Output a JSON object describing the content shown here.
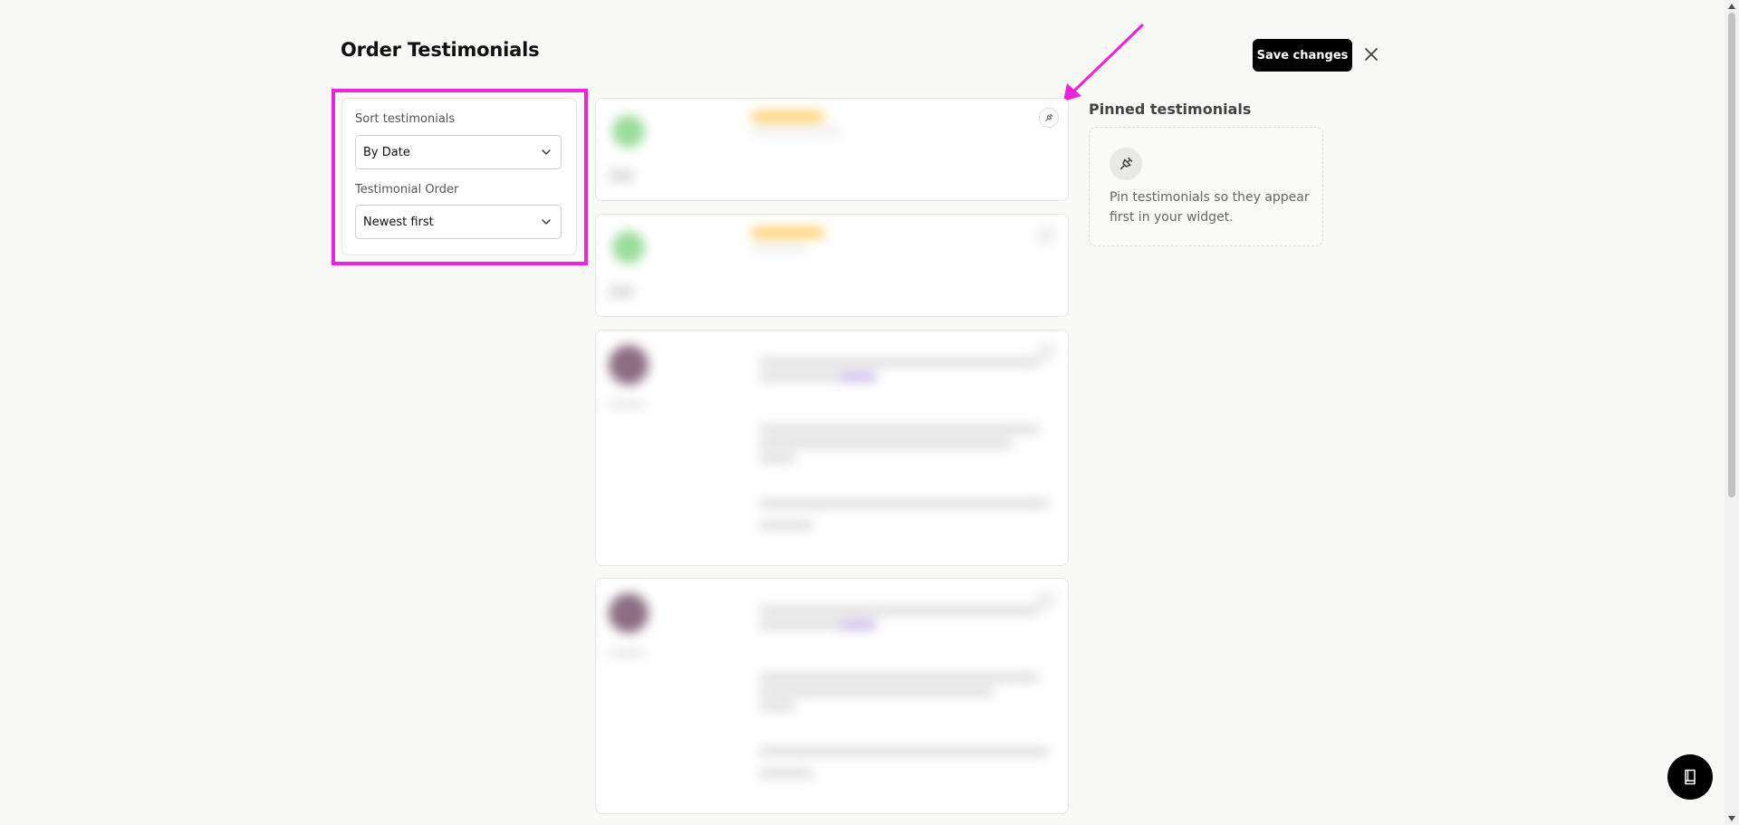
{
  "header": {
    "title": "Order Testimonials",
    "save_label": "Save changes"
  },
  "sort_panel": {
    "sort_label": "Sort testimonials",
    "sort_value": "By Date",
    "order_label": "Testimonial Order",
    "order_value": "Newest first"
  },
  "pinned": {
    "title": "Pinned testimonials",
    "empty_text": "Pin testimonials so they appear first in your widget."
  },
  "icons": {
    "close": "close-icon",
    "chevron": "chevron-down-icon",
    "pin": "pin-icon",
    "help": "book-icon"
  },
  "colors": {
    "accent": "#000000",
    "highlight": "#ee22dd"
  }
}
